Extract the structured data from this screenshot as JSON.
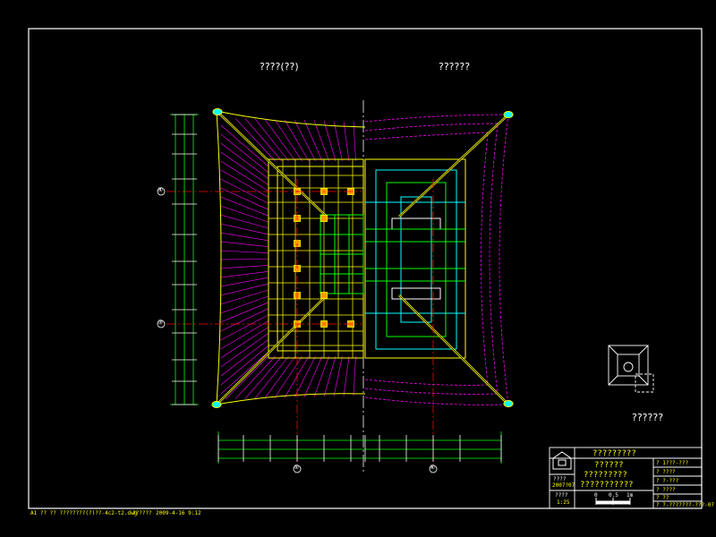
{
  "labels": {
    "plan_left_title": "????(??)",
    "plan_right_title": "??????",
    "detail_label": "??????"
  },
  "titleblock": {
    "header": "?????????",
    "project_lines": [
      "??????",
      "?????????",
      "???????????"
    ],
    "left_top_1": "????",
    "left_top_2": "2007?07",
    "left_bottom_1": "????",
    "left_bottom_2": "1:25",
    "right_rows": [
      "? 1???-???",
      "? ????",
      "? ?-???",
      "? ????",
      "? ??",
      "? ?-???????-???-07"
    ],
    "scale_ticks": [
      "0",
      "0.5",
      "1m"
    ]
  },
  "status_bar": {
    "left": "A1  ??   ??  ????????(?)??-4c2-t2.dwg",
    "middle": "??????",
    "right": "2009-4-16  9:12"
  },
  "axis_markers": {
    "left_upper": "④",
    "left_lower": "③",
    "bottom_left": "⑤",
    "bottom_right": "⑥"
  },
  "colors": {
    "background": "#000000",
    "frame": "#ffffff",
    "yellow": "#ffff00",
    "magenta": "#ff00ff",
    "cyan": "#00ffff",
    "green": "#00ff00",
    "red": "#ff0000"
  }
}
